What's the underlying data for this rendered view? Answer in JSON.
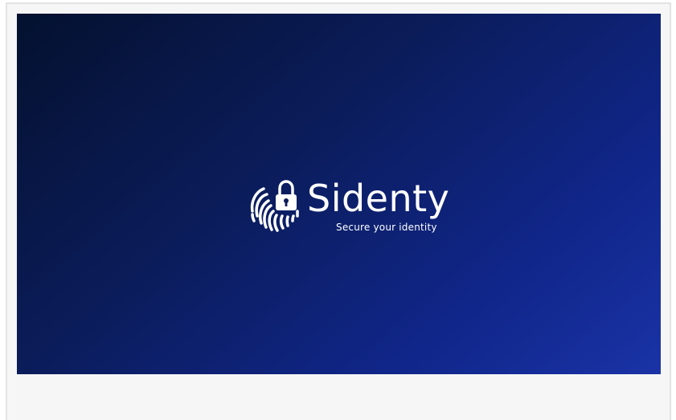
{
  "splash": {
    "brand_name": "Sidenty",
    "tagline": "Secure your identity",
    "logo_icon": "fingerprint-lock-icon"
  },
  "colors": {
    "gradient_start": "#04112f",
    "gradient_end": "#1a33a6",
    "text": "#ffffff",
    "frame_background": "#f6f6f6"
  }
}
